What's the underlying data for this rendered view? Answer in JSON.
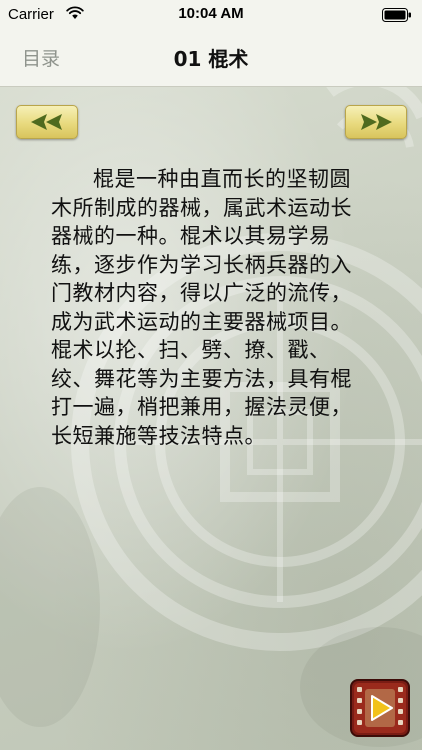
{
  "status_bar": {
    "carrier": "Carrier",
    "time": "10:04 AM"
  },
  "nav": {
    "back_label": "目录",
    "title": "01 棍术"
  },
  "controls": {
    "prev_icon": "double-left-arrow-icon",
    "next_icon": "double-right-arrow-icon",
    "video_icon": "film-play-icon"
  },
  "article": {
    "text": "棍是一种由直而长的坚韧圆木所制成的器械，属武术运动长器械的一种。棍术以其易学易练，逐步作为学习长柄兵器的入门教材内容，得以广泛的流传，成为武术运动的主要器械项目。棍术以抡、扫、劈、撩、戳、绞、舞花等为主要方法，具有棍打一遍，梢把兼用，握法灵便，长短兼施等技法特点。"
  },
  "colors": {
    "arrow_fill": "#e8da7e",
    "arrow_glyph": "#4f6a1f",
    "video_frame": "#7a1c14",
    "play_fill": "#f2c21b"
  }
}
